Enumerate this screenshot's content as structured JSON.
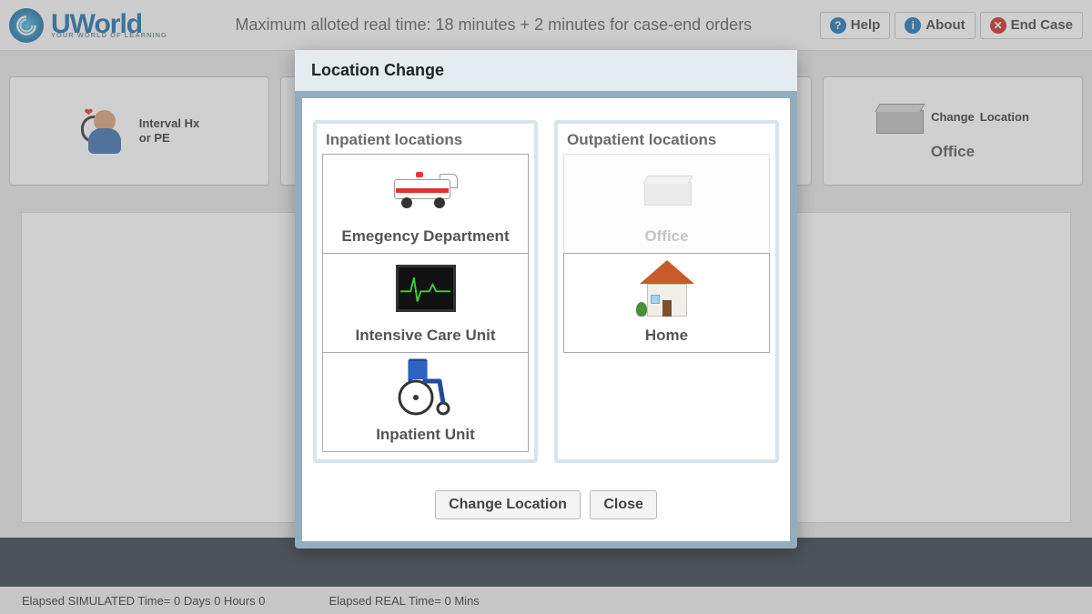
{
  "brand": {
    "name": "UWorld",
    "tagline": "YOUR WORLD OF LEARNING"
  },
  "header": {
    "allotted": "Maximum alloted real time: 18 minutes + 2 minutes for case-end orders",
    "buttons": {
      "help": "Help",
      "about": "About",
      "end": "End Case"
    }
  },
  "cards": {
    "interval": {
      "line1": "Interval Hx",
      "line2": "or PE"
    },
    "change": {
      "line1": "Change",
      "line2": "Location",
      "current": "Office"
    }
  },
  "modal": {
    "title": "Location Change",
    "inpatient_header": "Inpatient locations",
    "outpatient_header": "Outpatient locations",
    "inpatient": [
      {
        "name": "Emegency Department"
      },
      {
        "name": "Intensive Care Unit"
      },
      {
        "name": "Inpatient Unit"
      }
    ],
    "outpatient": [
      {
        "name": "Office",
        "disabled": true
      },
      {
        "name": "Home"
      }
    ],
    "actions": {
      "change": "Change Location",
      "close": "Close"
    }
  },
  "status": {
    "sim": "Elapsed SIMULATED Time= 0 Days 0 Hours 0",
    "real": "Elapsed REAL Time= 0 Mins"
  }
}
